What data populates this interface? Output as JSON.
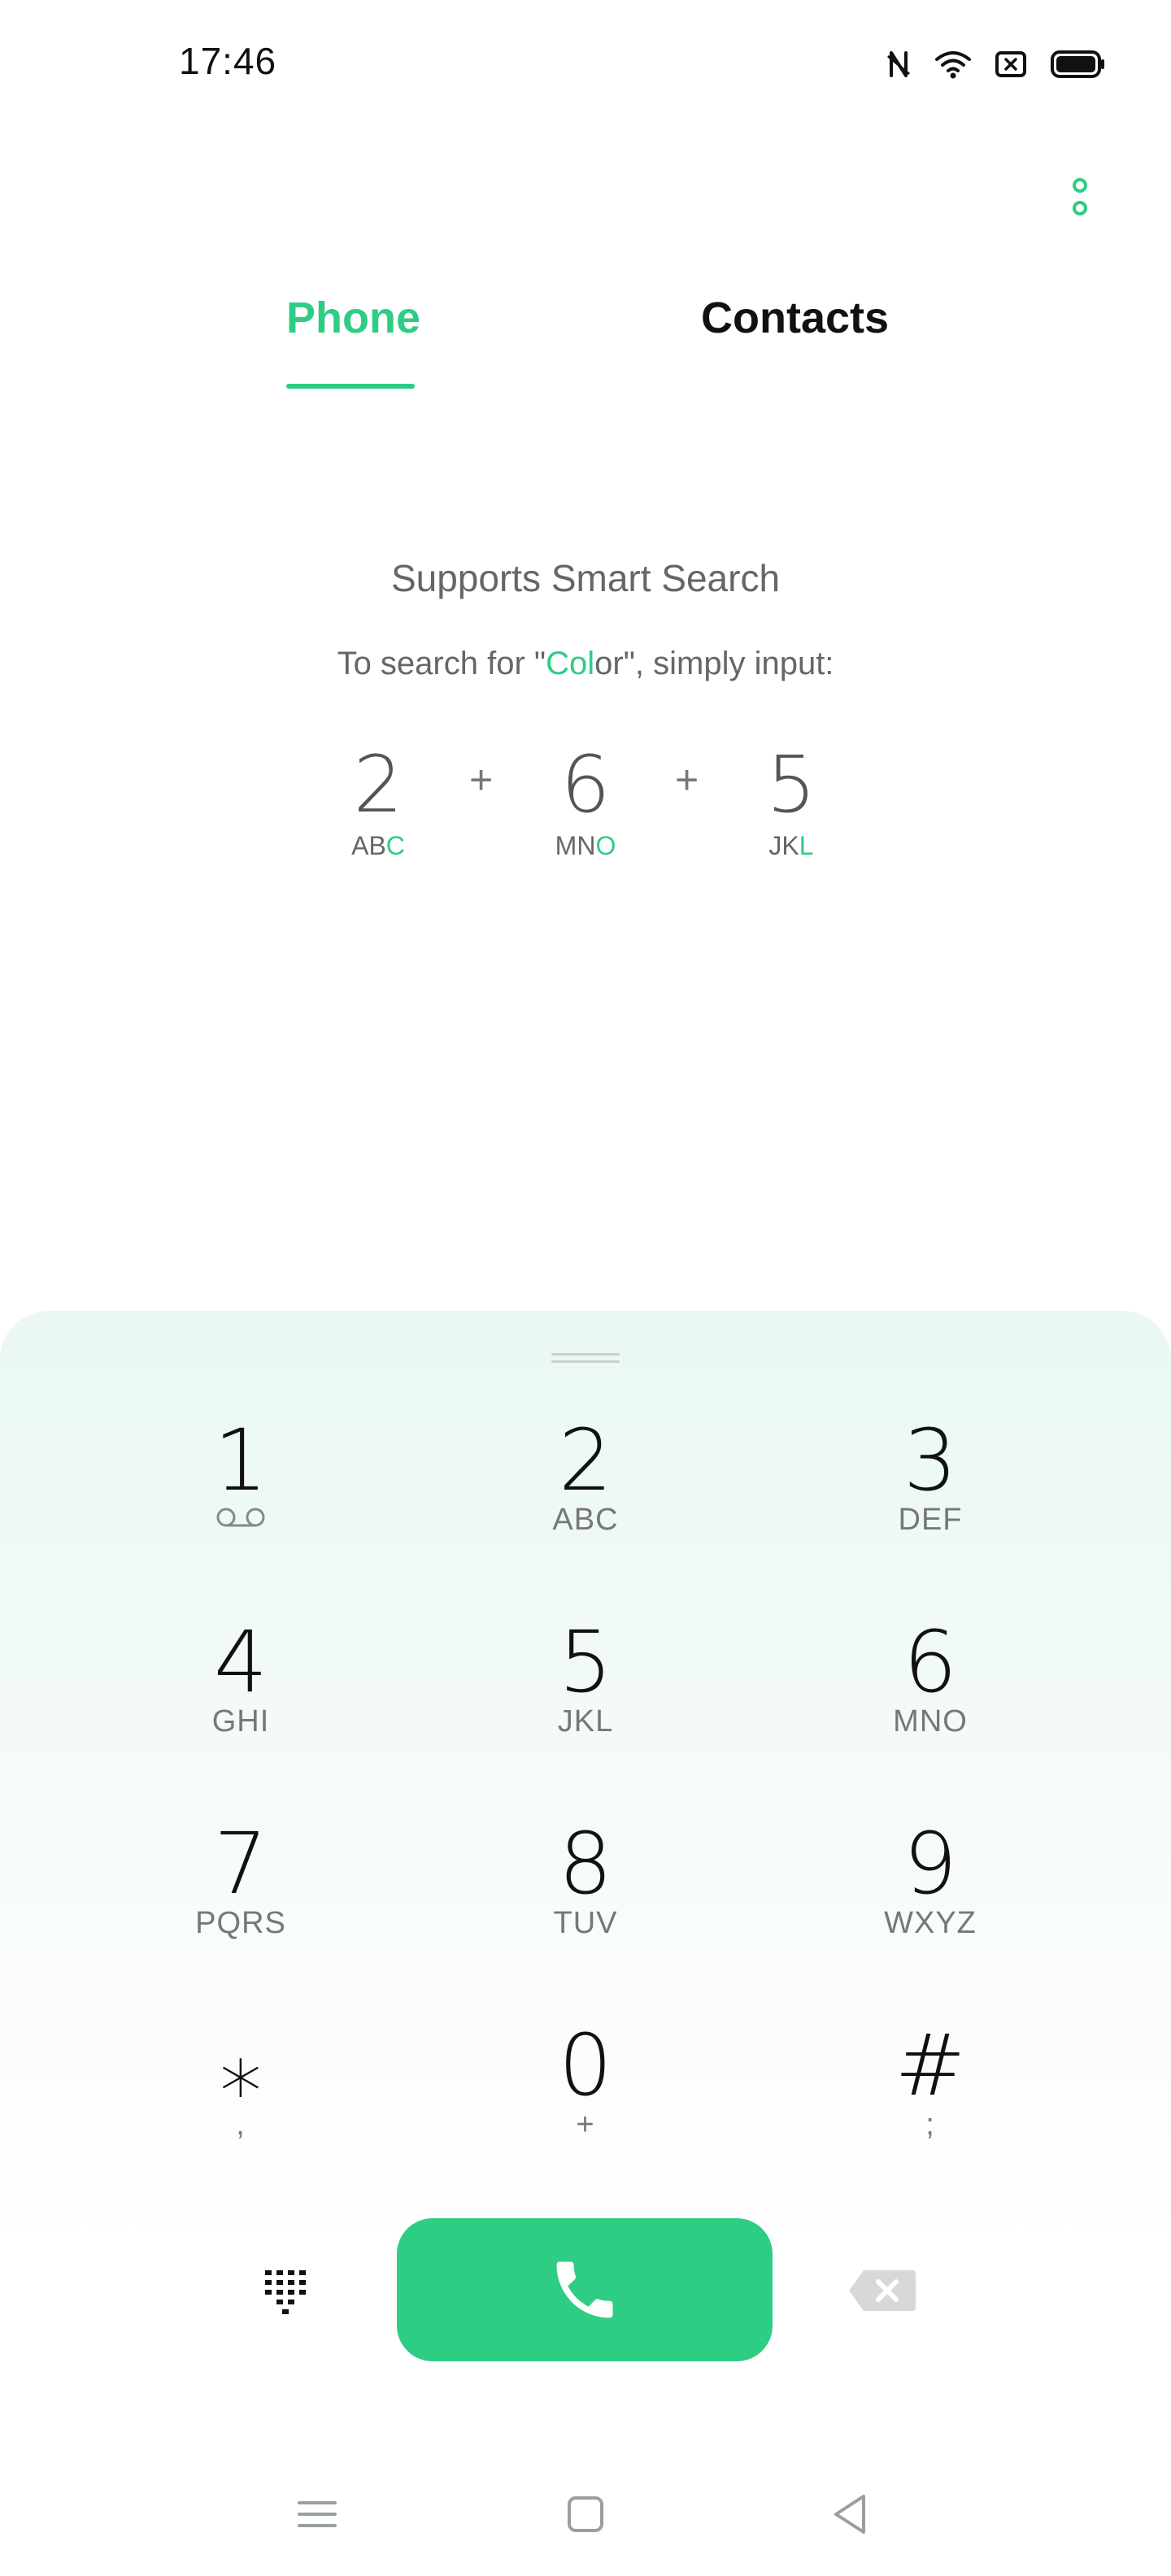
{
  "status_bar": {
    "time": "17:46"
  },
  "tabs": {
    "phone": "Phone",
    "contacts": "Contacts"
  },
  "smart_search": {
    "title": "Supports Smart Search",
    "subtitle_prefix": "To search for \"",
    "subtitle_highlight": "Col",
    "subtitle_rest": "or\", simply input:",
    "example": [
      {
        "digit": "2",
        "letters_plain": "AB",
        "letters_highlight": "C"
      },
      {
        "digit": "6",
        "letters_plain": "MN",
        "letters_highlight": "O"
      },
      {
        "digit": "5",
        "letters_plain": "JK",
        "letters_highlight": "L"
      }
    ],
    "plus": "+"
  },
  "keypad": [
    {
      "num": "1",
      "letters": ""
    },
    {
      "num": "2",
      "letters": "ABC"
    },
    {
      "num": "3",
      "letters": "DEF"
    },
    {
      "num": "4",
      "letters": "GHI"
    },
    {
      "num": "5",
      "letters": "JKL"
    },
    {
      "num": "6",
      "letters": "MNO"
    },
    {
      "num": "7",
      "letters": "PQRS"
    },
    {
      "num": "8",
      "letters": "TUV"
    },
    {
      "num": "9",
      "letters": "WXYZ"
    },
    {
      "num": "⁎",
      "letters": ","
    },
    {
      "num": "0",
      "letters": "+"
    },
    {
      "num": "#",
      "letters": ";"
    }
  ],
  "icons": {
    "voicemail": "voicemail-icon",
    "menu": "more-vertical-icon",
    "call": "phone-icon",
    "dialpad": "dialpad-icon",
    "backspace": "backspace-icon"
  },
  "colors": {
    "accent": "#2ecd84",
    "text": "#111111",
    "muted": "#777777"
  }
}
